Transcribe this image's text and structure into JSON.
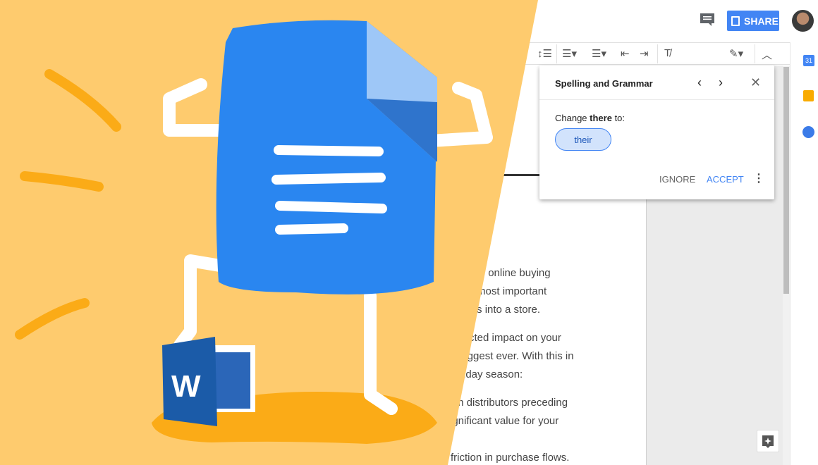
{
  "header": {
    "share_label": "SHARE",
    "icons": [
      "comment-icon",
      "share-lock-icon",
      "avatar"
    ]
  },
  "toolbar": {
    "icons": [
      "line-spacing-icon",
      "numbered-list-icon",
      "bulleted-list-icon",
      "decrease-indent-icon",
      "increase-indent-icon",
      "clear-formatting-icon",
      "editing-mode-pencil-icon",
      "collapse-chevron-up-icon"
    ]
  },
  "side_panel": {
    "icons": [
      "calendar-icon",
      "keep-icon",
      "tasks-icon"
    ],
    "calendar_day": "31"
  },
  "spelling_popup": {
    "title": "Spelling and Grammar",
    "prompt_prefix": "Change ",
    "prompt_word": "there",
    "prompt_suffix": " to:",
    "suggestion": "their",
    "ignore_label": "IGNORE",
    "accept_label": "ACCEPT"
  },
  "document": {
    "lines": [
      "hen online buying",
      "the most important",
      "ppers into a store.",
      "cted impact on your",
      "biggest ever. With this in",
      "iday season:",
      "m distributors preceding",
      "ignificant value for your",
      "friction in purchase flows."
    ]
  },
  "colors": {
    "accent": "#4285f4",
    "banner": "#fecb6e",
    "doc_blue": "#2a86f0",
    "word_blue": "#1b5ba8",
    "stroke_orange": "#fbab17"
  }
}
